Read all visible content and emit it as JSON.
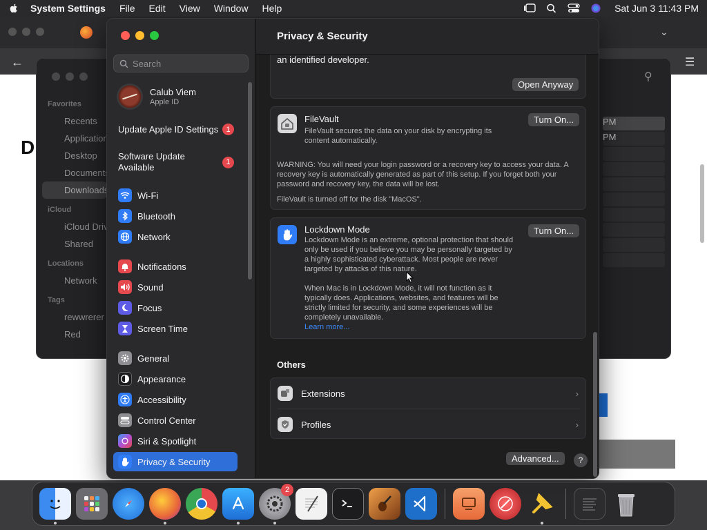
{
  "menubar": {
    "app_name": "System Settings",
    "menus": [
      "File",
      "Edit",
      "View",
      "Window",
      "Help"
    ],
    "clock": "Sat Jun 3  11:43 PM",
    "status_icons": [
      "stage-manager-icon",
      "search-icon",
      "control-center-icon",
      "siri-icon"
    ]
  },
  "background": {
    "page_letter": "D",
    "finder_sidebar": {
      "favorites_label": "Favorites",
      "favorites": [
        "Recents",
        "Applications",
        "Desktop",
        "Documents",
        "Downloads"
      ],
      "icloud_label": "iCloud",
      "icloud": [
        "iCloud Drive",
        "Shared"
      ],
      "locations_label": "Locations",
      "locations": [
        "Network"
      ],
      "tags_label": "Tags",
      "tags": [
        "rewwrerer",
        "Red"
      ]
    },
    "finder_list": [
      "PM",
      "PM"
    ]
  },
  "sidebar": {
    "search_placeholder": "Search",
    "profile": {
      "name": "Calub Viem",
      "subtitle": "Apple ID"
    },
    "notices": [
      {
        "label": "Update Apple ID Settings",
        "badge": "1"
      },
      {
        "label": "Software Update Available",
        "badge": "1"
      }
    ],
    "items": [
      {
        "label": "Wi-Fi",
        "icon": "wifi-icon",
        "color": "#2f7cf6"
      },
      {
        "label": "Bluetooth",
        "icon": "bluetooth-icon",
        "color": "#2f7cf6"
      },
      {
        "label": "Network",
        "icon": "globe-icon",
        "color": "#2f7cf6"
      },
      {
        "label": "Notifications",
        "icon": "bell-icon",
        "color": "#e5484d"
      },
      {
        "label": "Sound",
        "icon": "speaker-icon",
        "color": "#e5484d"
      },
      {
        "label": "Focus",
        "icon": "moon-icon",
        "color": "#5e5ce6"
      },
      {
        "label": "Screen Time",
        "icon": "hourglass-icon",
        "color": "#5e5ce6"
      },
      {
        "label": "General",
        "icon": "gear-icon",
        "color": "#8e8e93"
      },
      {
        "label": "Appearance",
        "icon": "appearance-icon",
        "color": "#1c1c1e"
      },
      {
        "label": "Accessibility",
        "icon": "accessibility-icon",
        "color": "#2f7cf6"
      },
      {
        "label": "Control Center",
        "icon": "control-center-icon",
        "color": "#8e8e93"
      },
      {
        "label": "Siri & Spotlight",
        "icon": "siri-icon",
        "color": "#b04fd6"
      },
      {
        "label": "Privacy & Security",
        "icon": "hand-icon",
        "color": "#2f7cf6"
      }
    ],
    "active": "Privacy & Security"
  },
  "main": {
    "title": "Privacy & Security",
    "developer_text": "an identified developer.",
    "open_anyway": "Open Anyway",
    "filevault": {
      "title": "FileVault",
      "desc": "FileVault secures the data on your disk by encrypting its content automatically.",
      "button": "Turn On...",
      "warning": "WARNING: You will need your login password or a recovery key to access your data. A recovery key is automatically generated as part of this setup. If you forget both your password and recovery key, the data will be lost.",
      "status": "FileVault is turned off for the disk \"MacOS\"."
    },
    "lockdown": {
      "title": "Lockdown Mode",
      "desc": "Lockdown Mode is an extreme, optional protection that should only be used if you believe you may be personally targeted by a highly sophisticated cyberattack. Most people are never targeted by attacks of this nature.",
      "desc2": "When Mac is in Lockdown Mode, it will not function as it typically does. Applications, websites, and features will be strictly limited for security, and some experiences will be completely unavailable.",
      "learn_more": "Learn more...",
      "button": "Turn On..."
    },
    "others_header": "Others",
    "others": [
      {
        "label": "Extensions",
        "icon": "extensions-icon"
      },
      {
        "label": "Profiles",
        "icon": "profiles-icon"
      }
    ],
    "advanced": "Advanced...",
    "help": "?"
  },
  "dock": {
    "apps": [
      {
        "name": "Finder",
        "icon": "finder-icon",
        "color": "#3b8bf0",
        "running": true
      },
      {
        "name": "Launchpad",
        "icon": "launchpad-icon",
        "color": "#6b6b70",
        "running": false
      },
      {
        "name": "Safari",
        "icon": "safari-icon",
        "color": "#2f8ef0",
        "running": false
      },
      {
        "name": "Firefox",
        "icon": "firefox-icon",
        "color": "#e8663a",
        "running": true
      },
      {
        "name": "Chrome",
        "icon": "chrome-icon",
        "color": "#ffffff",
        "running": false
      },
      {
        "name": "App Store",
        "icon": "app-store-icon",
        "color": "#1f8cf0",
        "running": true
      },
      {
        "name": "System Settings",
        "icon": "settings-icon",
        "color": "#8e8e93",
        "running": true,
        "badge": "2"
      },
      {
        "name": "TextEdit",
        "icon": "textedit-icon",
        "color": "#f2f2f2",
        "running": false
      },
      {
        "name": "Terminal",
        "icon": "terminal-icon",
        "color": "#1c1c1e",
        "running": false
      },
      {
        "name": "GarageBand",
        "icon": "garageband-icon",
        "color": "#d9882e",
        "running": false
      },
      {
        "name": "VS Code",
        "icon": "vscode-icon",
        "color": "#1e6fc9",
        "running": false
      }
    ],
    "apps_right": [
      {
        "name": "Remote Desktop",
        "icon": "screen-icon",
        "color": "#f07a4a",
        "running": false
      },
      {
        "name": "Compass",
        "icon": "compass-icon",
        "color": "#e5484d",
        "running": false
      },
      {
        "name": "Pin",
        "icon": "pin-icon",
        "color": "#f2c230",
        "running": true
      }
    ],
    "stack": {
      "name": "Downloads",
      "icon": "stack-icon"
    },
    "trash": {
      "name": "Trash",
      "icon": "trash-icon"
    }
  }
}
